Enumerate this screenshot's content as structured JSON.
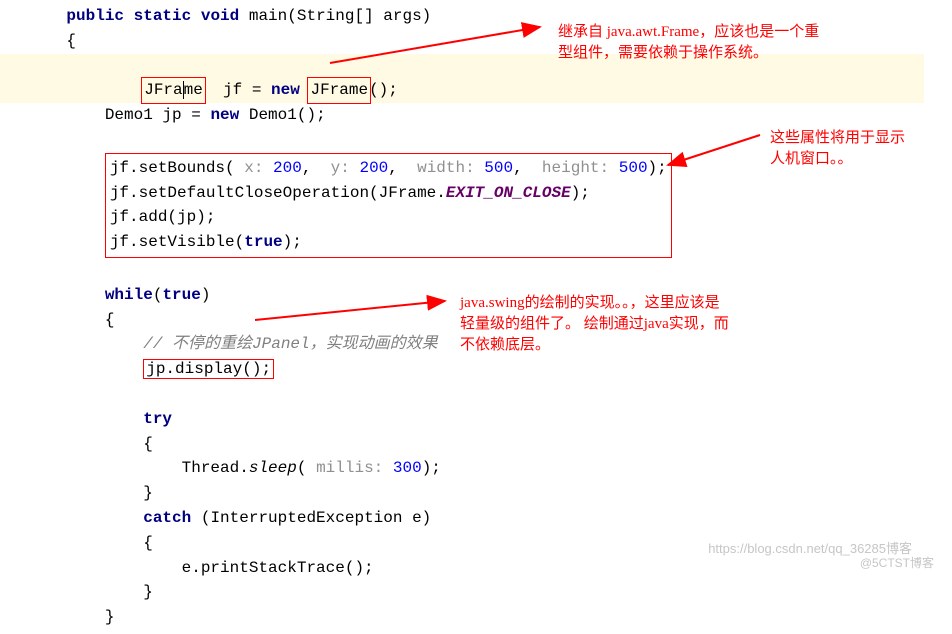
{
  "code": {
    "kw_public": "public",
    "kw_static": "static",
    "kw_void": "void",
    "kw_new": "new",
    "kw_while": "while",
    "kw_true": "true",
    "kw_try": "try",
    "kw_catch": "catch",
    "main_sig": " main(String[] args)",
    "lbrace": "{",
    "rbrace": "}",
    "jframe1": "JFra",
    "jframe1b": "me",
    "jf_decl": "  jf = ",
    "jframe2": "JFrame",
    "jframe2_paren": "();",
    "demo_decl": "Demo1 jp = ",
    "demo_new": " Demo1();",
    "setbounds_pre": "jf.setBounds(",
    "hint_x": " x: ",
    "num_200a": "200",
    "comma": ", ",
    "hint_y": " y: ",
    "num_200b": "200",
    "hint_w": " width: ",
    "num_500a": "500",
    "hint_h": " height: ",
    "num_500b": "500",
    "setbounds_end": ");",
    "setclose": "jf.setDefaultCloseOperation(JFrame.",
    "exit_const": "EXIT_ON_CLOSE",
    "close_end": ");",
    "add_jp": "jf.add(jp);",
    "setvisible_pre": "jf.setVisible(",
    "setvisible_end": ");",
    "while_open": "(",
    "while_close": ")",
    "comment_redraw": "// 不停的重绘JPanel，实现动画的效果",
    "jp_display": "jp.display();",
    "thread_pre": "Thread.",
    "sleep": "sleep",
    "sleep_open": "(",
    "hint_millis": " millis: ",
    "num_300": "300",
    "sleep_end": ");",
    "catch_sig": " (InterruptedException e)",
    "print_stack": "e.printStackTrace();"
  },
  "annotations": {
    "a1_line1": "继承自  java.awt.Frame，应该也是一个重",
    "a1_line2": "型组件，需要依赖于操作系统。",
    "a2_line1": "这些属性将用于显示",
    "a2_line2": "人机窗口。。",
    "a3_line1": "java.swing的绘制的实现。。，这里应该是",
    "a3_line2": "轻量级的组件了。   绘制通过java实现，而",
    "a3_line3": "不依赖底层。"
  },
  "watermark": {
    "w1": "https://blog.csdn.net/qq_36285博客",
    "w2": "@5CTST博客"
  }
}
